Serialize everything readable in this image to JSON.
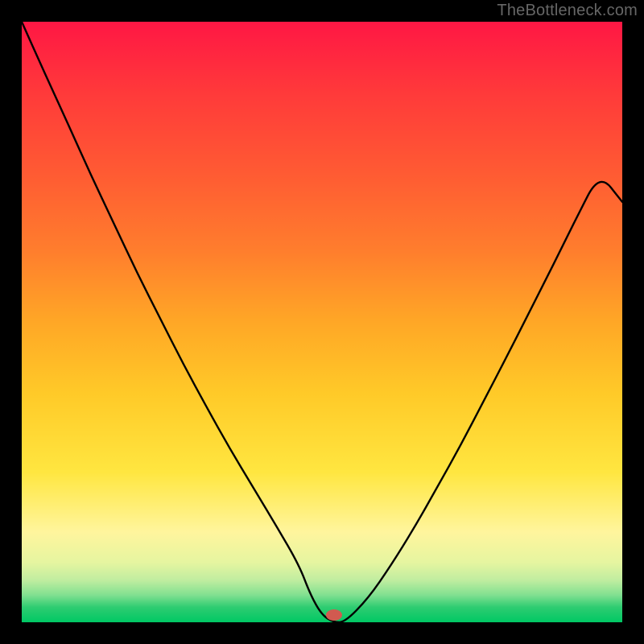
{
  "watermark": "TheBottleneck.com",
  "chart_data": {
    "type": "line",
    "title": "",
    "xlabel": "",
    "ylabel": "",
    "xlim": [
      0,
      100
    ],
    "ylim": [
      0,
      100
    ],
    "grid": false,
    "gradient_stops": [
      {
        "offset": 0.0,
        "color": "#ff1744"
      },
      {
        "offset": 0.12,
        "color": "#ff3a3a"
      },
      {
        "offset": 0.25,
        "color": "#ff5a33"
      },
      {
        "offset": 0.38,
        "color": "#ff7d2d"
      },
      {
        "offset": 0.5,
        "color": "#ffa726"
      },
      {
        "offset": 0.62,
        "color": "#ffca28"
      },
      {
        "offset": 0.75,
        "color": "#ffe640"
      },
      {
        "offset": 0.85,
        "color": "#fff59d"
      },
      {
        "offset": 0.9,
        "color": "#e6f5a0"
      },
      {
        "offset": 0.93,
        "color": "#c0eda0"
      },
      {
        "offset": 0.955,
        "color": "#80e090"
      },
      {
        "offset": 0.975,
        "color": "#2ecc71"
      },
      {
        "offset": 1.0,
        "color": "#00c864"
      }
    ],
    "series": [
      {
        "name": "bottleneck-curve",
        "x_norm": [
          0.0,
          0.038,
          0.077,
          0.115,
          0.154,
          0.192,
          0.231,
          0.269,
          0.308,
          0.346,
          0.385,
          0.423,
          0.462,
          0.481,
          0.5,
          0.519,
          0.538,
          0.577,
          0.615,
          0.654,
          0.692,
          0.731,
          0.769,
          0.808,
          0.846,
          0.885,
          0.923,
          0.962,
          1.0
        ],
        "y_norm": [
          1.0,
          0.915,
          0.83,
          0.745,
          0.663,
          0.582,
          0.505,
          0.43,
          0.358,
          0.29,
          0.225,
          0.162,
          0.095,
          0.045,
          0.012,
          0.0,
          0.0,
          0.04,
          0.095,
          0.158,
          0.225,
          0.295,
          0.368,
          0.443,
          0.518,
          0.595,
          0.672,
          0.748,
          0.7
        ],
        "color": "#000000",
        "width": 2.4
      }
    ],
    "marker": {
      "x_norm": 0.52,
      "y_norm": 0.012,
      "rx": 10,
      "ry": 7,
      "fill": "#d15a50"
    }
  }
}
